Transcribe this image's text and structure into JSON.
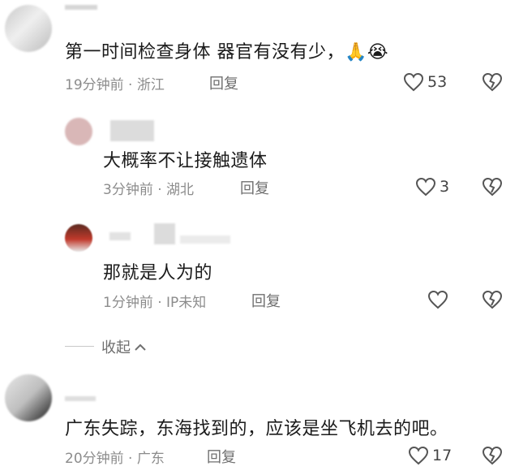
{
  "comments": [
    {
      "text": "第一时间检查身体 器官有没有少，",
      "emoji": "🙏😭",
      "time": "19分钟前",
      "location": "浙江",
      "reply_label": "回复",
      "likes": "53"
    }
  ],
  "replies": [
    {
      "text": "大概率不让接触遗体",
      "time": "3分钟前",
      "location": "湖北",
      "reply_label": "回复",
      "likes": "3"
    },
    {
      "text": "那就是人为的",
      "time": "1分钟前",
      "location": "IP未知",
      "reply_label": "回复",
      "likes": ""
    }
  ],
  "collapse": {
    "label": "收起"
  },
  "comment2": {
    "text": "广东失踪，东海找到的，应该是坐飞机去的吧。",
    "time": "20分钟前",
    "location": "广东",
    "reply_label": "回复",
    "likes": "17"
  },
  "separator": "·"
}
